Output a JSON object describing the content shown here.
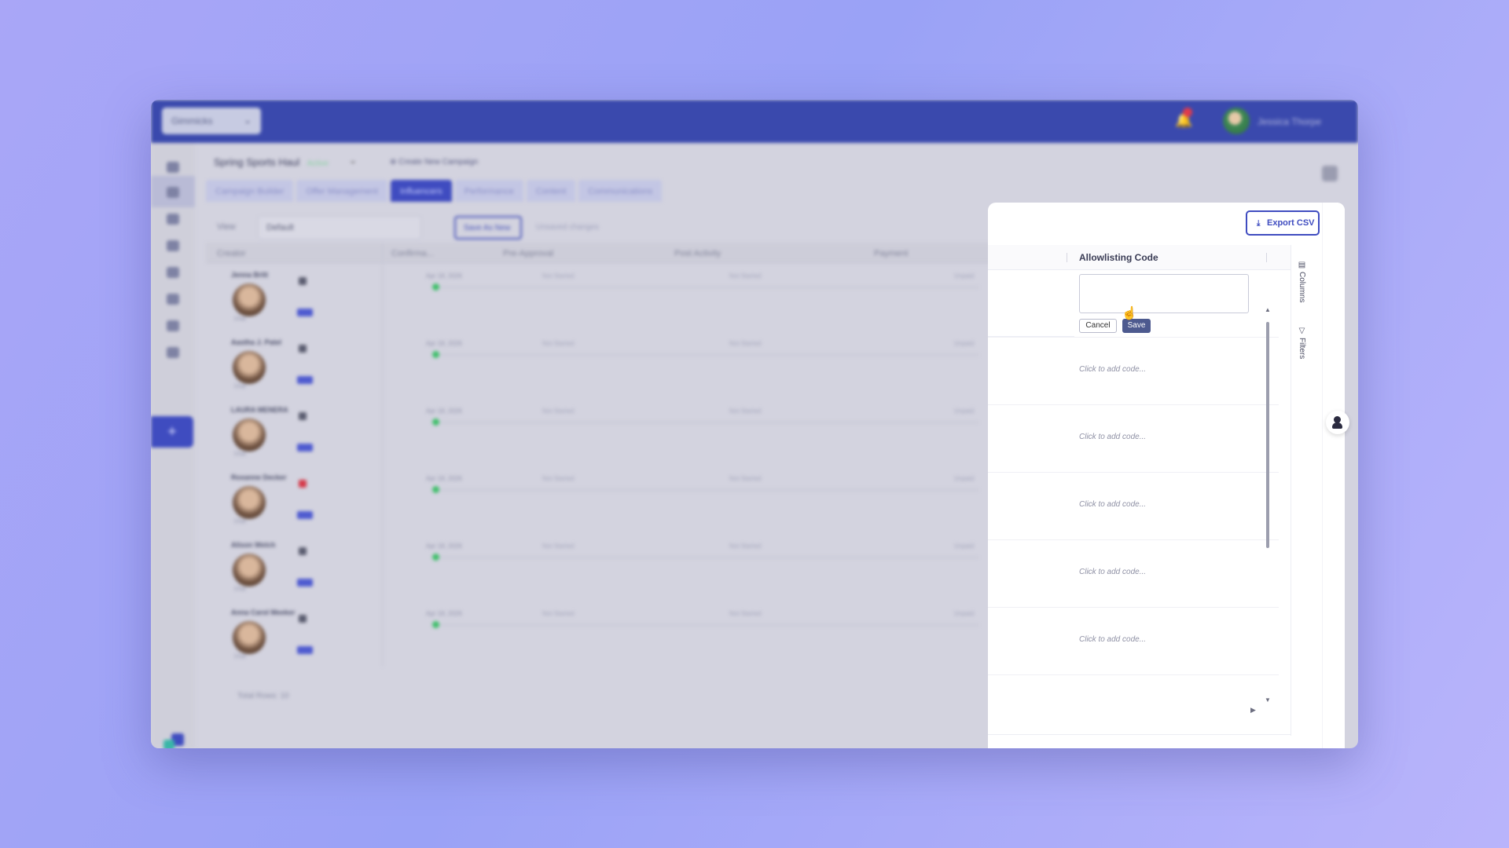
{
  "header": {
    "company_select": "Gimmicks",
    "user_name": "Jessica Thorpe"
  },
  "campaign": {
    "name": "Spring Sports Haul",
    "status": "Active",
    "create_link": "⊕ Create New Campaign"
  },
  "tabs": [
    {
      "label": "Campaign Builder"
    },
    {
      "label": "Offer Management"
    },
    {
      "label": "Influencers"
    },
    {
      "label": "Performance"
    },
    {
      "label": "Content"
    },
    {
      "label": "Communications"
    }
  ],
  "toolbar": {
    "view_label": "View",
    "view_value": "Default",
    "save_view_label": "Save As New",
    "unsaved_label": "Unsaved changes"
  },
  "table": {
    "columns": [
      "Creator",
      "Confirma...",
      "Pre-Approval",
      "Post Activity",
      "Payment"
    ],
    "rows": [
      {
        "name": "Jenna Britt",
        "date": "Apr 18, 2026",
        "pre": "Not Started",
        "post": "Not Started",
        "payment": "Unpaid",
        "icon": "tiktok"
      },
      {
        "name": "Aastha J. Patel",
        "date": "Apr 18, 2026",
        "pre": "Not Started",
        "post": "Not Started",
        "payment": "Unpaid",
        "icon": "tiktok"
      },
      {
        "name": "LAURA MENERA",
        "date": "Apr 18, 2026",
        "pre": "Not Started",
        "post": "Not Started",
        "payment": "Unpaid",
        "icon": "tiktok"
      },
      {
        "name": "Roxanne Decker",
        "date": "Apr 18, 2026",
        "pre": "Not Started",
        "post": "Not Started",
        "payment": "Unpaid",
        "icon": "youtube"
      },
      {
        "name": "Alison Welch",
        "date": "Apr 18, 2026",
        "pre": "Not Started",
        "post": "Not Started",
        "payment": "Unpaid",
        "icon": "tiktok"
      },
      {
        "name": "Anna Carol Meeker",
        "date": "Apr 18, 2026",
        "pre": "Not Started",
        "post": "Not Started",
        "payment": "Unpaid",
        "icon": "tiktok"
      }
    ],
    "chat_label": "Chat",
    "total_rows": "Total Rows: 10"
  },
  "panel": {
    "export_label": "Export CSV",
    "column_title": "Allowlisting Code",
    "cancel_label": "Cancel",
    "save_label": "Save",
    "placeholders": [
      "Click to add code...",
      "Click to add code...",
      "Click to add code...",
      "Click to add code...",
      "Click to add code..."
    ],
    "side_tabs": {
      "columns": "Columns",
      "filters": "Filters"
    }
  },
  "colors": {
    "brand": "#3f4cc0",
    "topbar": "#3a49ad",
    "background": "#a9a6f7",
    "status_green": "#3fbf6a"
  }
}
